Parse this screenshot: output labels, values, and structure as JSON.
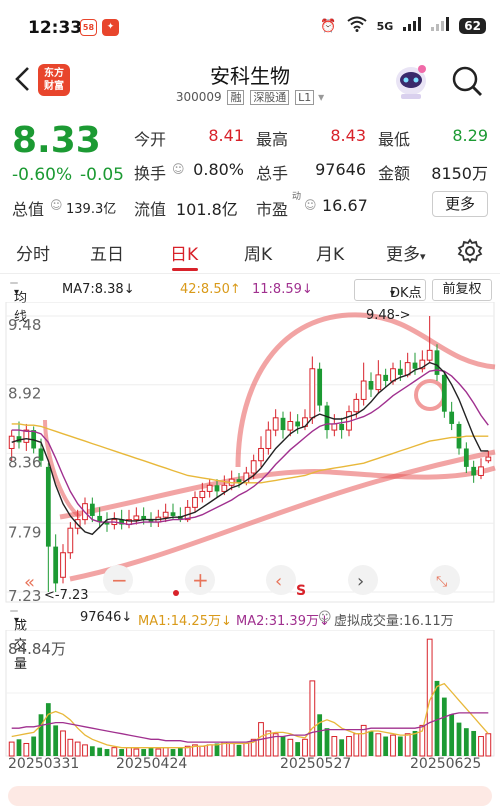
{
  "status_bar": {
    "time": "12:33",
    "app1": "58",
    "network": "5G",
    "battery": "62"
  },
  "header": {
    "logo_line1": "东方",
    "logo_line2": "财富",
    "stock_name": "安科生物",
    "stock_code": "300009",
    "tags": [
      "融",
      "深股通",
      "L1"
    ]
  },
  "quote": {
    "price": "8.33",
    "change_pct": "-0.60%",
    "change": "-0.05",
    "open_label": "今开",
    "open": "8.41",
    "high_label": "最高",
    "high": "8.43",
    "low_label": "最低",
    "low": "8.29",
    "turnover_label": "换手",
    "turnover": "0.80%",
    "volume_label": "总手",
    "volume": "97646",
    "amount_label": "金额",
    "amount": "8150万",
    "mktcap_label": "总值",
    "mktcap": "139.3亿",
    "float_label": "流值",
    "float": "101.8亿",
    "pe_label": "市盈",
    "pe_sup": "动",
    "pe": "16.67",
    "more_label": "更多"
  },
  "tabs": [
    "分时",
    "五日",
    "日K",
    "周K",
    "月K",
    "更多"
  ],
  "active_tab": "日K",
  "indicators": {
    "ma_label": "均线",
    "ma7": "MA7:8.38↓",
    "ma42": "42:8.50↑",
    "ma11": "11:8.59↓",
    "dk_label": "DK点",
    "adjust_label": "前复权"
  },
  "chart_controls": {
    "s_label": "S"
  },
  "volume_panel": {
    "label": "成交量",
    "vol": "97646↓",
    "ma1": "MA1:14.25万↓",
    "ma2": "MA2:31.39万↓",
    "virtual": "虚拟成交量:16.11万",
    "max_label": "84.84万"
  },
  "colors": {
    "up": "#d8222a",
    "down": "#1c9a33",
    "ma7": "#222222",
    "ma42": "#e8b83a",
    "ma11": "#a0308f"
  },
  "chart_data": {
    "type": "candlestick",
    "y_ticks": [
      "9.48",
      "8.92",
      "8.36",
      "7.79",
      "7.23"
    ],
    "ylim": [
      7.23,
      9.48
    ],
    "x_labels": [
      "20250331",
      "20250424",
      "20250527",
      "20250625"
    ],
    "annotations": {
      "high": "9.48->",
      "low": "<-7.23"
    },
    "candles": [
      [
        8.4,
        8.5,
        8.55,
        8.3
      ],
      [
        8.5,
        8.45,
        8.62,
        8.4
      ],
      [
        8.45,
        8.55,
        8.6,
        8.38
      ],
      [
        8.55,
        8.4,
        8.58,
        8.36
      ],
      [
        8.4,
        8.3,
        8.48,
        8.25
      ],
      [
        8.25,
        7.6,
        8.28,
        7.23
      ],
      [
        7.6,
        7.3,
        7.7,
        7.23
      ],
      [
        7.35,
        7.55,
        7.62,
        7.3
      ],
      [
        7.55,
        7.75,
        7.8,
        7.5
      ],
      [
        7.75,
        7.82,
        7.9,
        7.7
      ],
      [
        7.82,
        7.95,
        8.0,
        7.78
      ],
      [
        7.95,
        7.85,
        8.0,
        7.8
      ],
      [
        7.85,
        7.8,
        7.92,
        7.75
      ],
      [
        7.8,
        7.78,
        7.88,
        7.72
      ],
      [
        7.78,
        7.82,
        7.88,
        7.74
      ],
      [
        7.82,
        7.78,
        7.9,
        7.74
      ],
      [
        7.78,
        7.82,
        7.9,
        7.75
      ],
      [
        7.82,
        7.85,
        7.92,
        7.78
      ],
      [
        7.85,
        7.82,
        7.92,
        7.78
      ],
      [
        7.82,
        7.8,
        7.88,
        7.76
      ],
      [
        7.8,
        7.84,
        7.9,
        7.76
      ],
      [
        7.84,
        7.88,
        7.95,
        7.8
      ],
      [
        7.88,
        7.85,
        7.95,
        7.82
      ],
      [
        7.85,
        7.82,
        7.92,
        7.8
      ],
      [
        7.82,
        7.92,
        7.98,
        7.8
      ],
      [
        7.92,
        8.0,
        8.05,
        7.88
      ],
      [
        8.0,
        8.05,
        8.12,
        7.96
      ],
      [
        8.05,
        8.1,
        8.15,
        8.0
      ],
      [
        8.1,
        8.05,
        8.15,
        8.0
      ],
      [
        8.05,
        8.1,
        8.18,
        8.02
      ],
      [
        8.1,
        8.15,
        8.22,
        8.06
      ],
      [
        8.15,
        8.12,
        8.2,
        8.08
      ],
      [
        8.12,
        8.2,
        8.25,
        8.1
      ],
      [
        8.2,
        8.3,
        8.35,
        8.15
      ],
      [
        8.3,
        8.4,
        8.5,
        8.25
      ],
      [
        8.4,
        8.55,
        8.62,
        8.35
      ],
      [
        8.55,
        8.65,
        8.72,
        8.5
      ],
      [
        8.65,
        8.55,
        8.7,
        8.48
      ],
      [
        8.55,
        8.62,
        8.7,
        8.5
      ],
      [
        8.62,
        8.58,
        8.68,
        8.52
      ],
      [
        8.58,
        8.65,
        8.72,
        8.55
      ],
      [
        8.65,
        9.05,
        9.15,
        8.6
      ],
      [
        9.05,
        8.75,
        9.1,
        8.7
      ],
      [
        8.75,
        8.55,
        8.78,
        8.48
      ],
      [
        8.55,
        8.6,
        8.68,
        8.5
      ],
      [
        8.6,
        8.55,
        8.65,
        8.48
      ],
      [
        8.55,
        8.7,
        8.75,
        8.5
      ],
      [
        8.7,
        8.8,
        8.85,
        8.65
      ],
      [
        8.8,
        8.95,
        9.1,
        8.75
      ],
      [
        8.95,
        8.88,
        9.02,
        8.82
      ],
      [
        8.88,
        9.0,
        9.12,
        8.85
      ],
      [
        9.0,
        8.95,
        9.05,
        8.9
      ],
      [
        8.95,
        9.05,
        9.1,
        8.92
      ],
      [
        9.05,
        9.0,
        9.12,
        8.95
      ],
      [
        9.0,
        9.1,
        9.18,
        8.98
      ],
      [
        9.1,
        9.05,
        9.18,
        9.0
      ],
      [
        9.05,
        9.12,
        9.2,
        9.02
      ],
      [
        9.12,
        9.2,
        9.48,
        9.1
      ],
      [
        9.2,
        9.0,
        9.25,
        8.95
      ],
      [
        9.0,
        8.7,
        9.02,
        8.65
      ],
      [
        8.7,
        8.6,
        8.78,
        8.55
      ],
      [
        8.6,
        8.4,
        8.62,
        8.35
      ],
      [
        8.4,
        8.25,
        8.45,
        8.2
      ],
      [
        8.25,
        8.18,
        8.3,
        8.12
      ],
      [
        8.18,
        8.25,
        8.32,
        8.15
      ],
      [
        8.3,
        8.33,
        8.38,
        8.28
      ]
    ],
    "ma7": [
      8.45,
      8.47,
      8.48,
      8.47,
      8.45,
      8.3,
      8.1,
      7.95,
      7.85,
      7.78,
      7.72,
      7.7,
      7.76,
      7.82,
      7.83,
      7.82,
      7.81,
      7.81,
      7.82,
      7.82,
      7.82,
      7.83,
      7.84,
      7.84,
      7.86,
      7.88,
      7.92,
      7.96,
      8.0,
      8.04,
      8.08,
      8.1,
      8.14,
      8.18,
      8.24,
      8.32,
      8.4,
      8.46,
      8.52,
      8.56,
      8.58,
      8.65,
      8.68,
      8.66,
      8.64,
      8.64,
      8.66,
      8.68,
      8.72,
      8.78,
      8.85,
      8.9,
      8.95,
      8.98,
      9.0,
      9.04,
      9.06,
      9.1,
      9.08,
      9.02,
      8.92,
      8.8,
      8.65,
      8.5,
      8.38,
      8.38
    ],
    "ma42": [
      8.6,
      8.6,
      8.59,
      8.59,
      8.58,
      8.56,
      8.54,
      8.52,
      8.5,
      8.48,
      8.46,
      8.44,
      8.42,
      8.4,
      8.38,
      8.36,
      8.34,
      8.32,
      8.3,
      8.28,
      8.26,
      8.24,
      8.22,
      8.2,
      8.18,
      8.17,
      8.16,
      8.15,
      8.14,
      8.13,
      8.12,
      8.12,
      8.12,
      8.12,
      8.12,
      8.13,
      8.14,
      8.15,
      8.16,
      8.17,
      8.18,
      8.2,
      8.22,
      8.23,
      8.24,
      8.25,
      8.26,
      8.27,
      8.28,
      8.3,
      8.32,
      8.34,
      8.36,
      8.38,
      8.4,
      8.42,
      8.44,
      8.46,
      8.47,
      8.48,
      8.49,
      8.49,
      8.5,
      8.5,
      8.5,
      8.5
    ],
    "ma11": [
      8.55,
      8.55,
      8.54,
      8.54,
      8.52,
      8.45,
      8.32,
      8.18,
      8.05,
      7.95,
      7.88,
      7.82,
      7.8,
      7.8,
      7.8,
      7.79,
      7.78,
      7.79,
      7.8,
      7.8,
      7.8,
      7.81,
      7.82,
      7.82,
      7.83,
      7.84,
      7.86,
      7.89,
      7.92,
      7.95,
      7.98,
      8.02,
      8.05,
      8.09,
      8.14,
      8.2,
      8.27,
      8.33,
      8.39,
      8.44,
      8.49,
      8.54,
      8.58,
      8.6,
      8.6,
      8.61,
      8.62,
      8.64,
      8.66,
      8.69,
      8.73,
      8.78,
      8.83,
      8.87,
      8.91,
      8.95,
      8.99,
      9.03,
      9.04,
      9.03,
      8.99,
      8.93,
      8.86,
      8.77,
      8.67,
      8.59
    ],
    "volumes": [
      10,
      12,
      9,
      14,
      30,
      38,
      22,
      18,
      12,
      10,
      8,
      7,
      6,
      5,
      6,
      5,
      6,
      5,
      5,
      6,
      5,
      6,
      5,
      6,
      7,
      8,
      7,
      8,
      9,
      10,
      9,
      8,
      9,
      12,
      24,
      18,
      16,
      14,
      12,
      10,
      12,
      54,
      30,
      20,
      14,
      12,
      14,
      16,
      22,
      18,
      16,
      14,
      15,
      14,
      16,
      18,
      22,
      84,
      54,
      42,
      30,
      24,
      20,
      18,
      14,
      16
    ],
    "vol_ma1": [
      14,
      15,
      16,
      17,
      22,
      30,
      32,
      30,
      26,
      20,
      15,
      12,
      10,
      8,
      7,
      6,
      6,
      6,
      6,
      6,
      6,
      6,
      6,
      6,
      6,
      7,
      7,
      8,
      8,
      9,
      9,
      9,
      9,
      10,
      14,
      16,
      17,
      17,
      16,
      14,
      13,
      20,
      24,
      26,
      24,
      20,
      18,
      16,
      16,
      18,
      18,
      17,
      16,
      15,
      15,
      16,
      18,
      40,
      50,
      52,
      46,
      40,
      34,
      28,
      22,
      16
    ],
    "vol_ma2": [
      20,
      20,
      21,
      21,
      22,
      23,
      24,
      24,
      23,
      22,
      21,
      20,
      19,
      18,
      17,
      16,
      15,
      14,
      13,
      12,
      12,
      11,
      11,
      11,
      10,
      10,
      10,
      10,
      10,
      10,
      10,
      10,
      10,
      11,
      12,
      13,
      14,
      14,
      15,
      15,
      15,
      17,
      18,
      19,
      19,
      19,
      19,
      19,
      19,
      20,
      20,
      20,
      20,
      20,
      20,
      20,
      21,
      24,
      26,
      28,
      30,
      31,
      31,
      31,
      31,
      31
    ]
  }
}
